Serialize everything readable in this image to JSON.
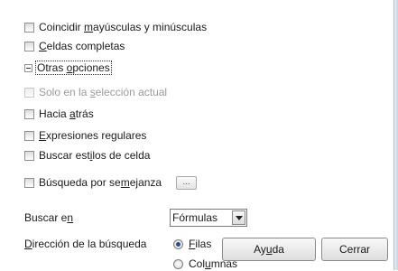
{
  "options": {
    "match_case": {
      "pre": "Coincidir ",
      "key": "m",
      "post": "ayúsculas y minúsculas",
      "checked": false
    },
    "whole_cells": {
      "pre": "",
      "key": "C",
      "post": "eldas completas",
      "checked": false
    }
  },
  "other_options": {
    "expander_state": "expanded",
    "pre": "Otras ",
    "key": "o",
    "post": "pciones"
  },
  "extra": {
    "current_selection": {
      "pre": "Solo en la ",
      "key": "s",
      "post": "elección actual",
      "disabled": true,
      "checked": false
    },
    "backwards": {
      "pre": "Hacia ",
      "key": "a",
      "post": "trás",
      "checked": false
    },
    "regex": {
      "pre": "",
      "key": "E",
      "post": "xpresiones regulares",
      "checked": false
    },
    "cell_styles": {
      "pre": "Buscar est",
      "key": "i",
      "post": "los de celda",
      "checked": false
    },
    "similarity": {
      "pre": "Búsqueda por se",
      "key": "m",
      "post": "ejanza",
      "checked": false,
      "button_label": "..."
    }
  },
  "search_in": {
    "pre": "Buscar e",
    "key": "n",
    "post": "",
    "value": "Fórmulas"
  },
  "direction": {
    "pre": "",
    "key": "D",
    "post": "irección de la búsqueda",
    "rows": {
      "pre": "",
      "key": "F",
      "post": "ilas",
      "checked": true
    },
    "columns": {
      "pre": "Col",
      "key": "u",
      "post": "mnas",
      "checked": false
    }
  },
  "buttons": {
    "help": {
      "pre": "Ay",
      "key": "u",
      "post": "da"
    },
    "close": {
      "label": "Cerrar"
    }
  }
}
